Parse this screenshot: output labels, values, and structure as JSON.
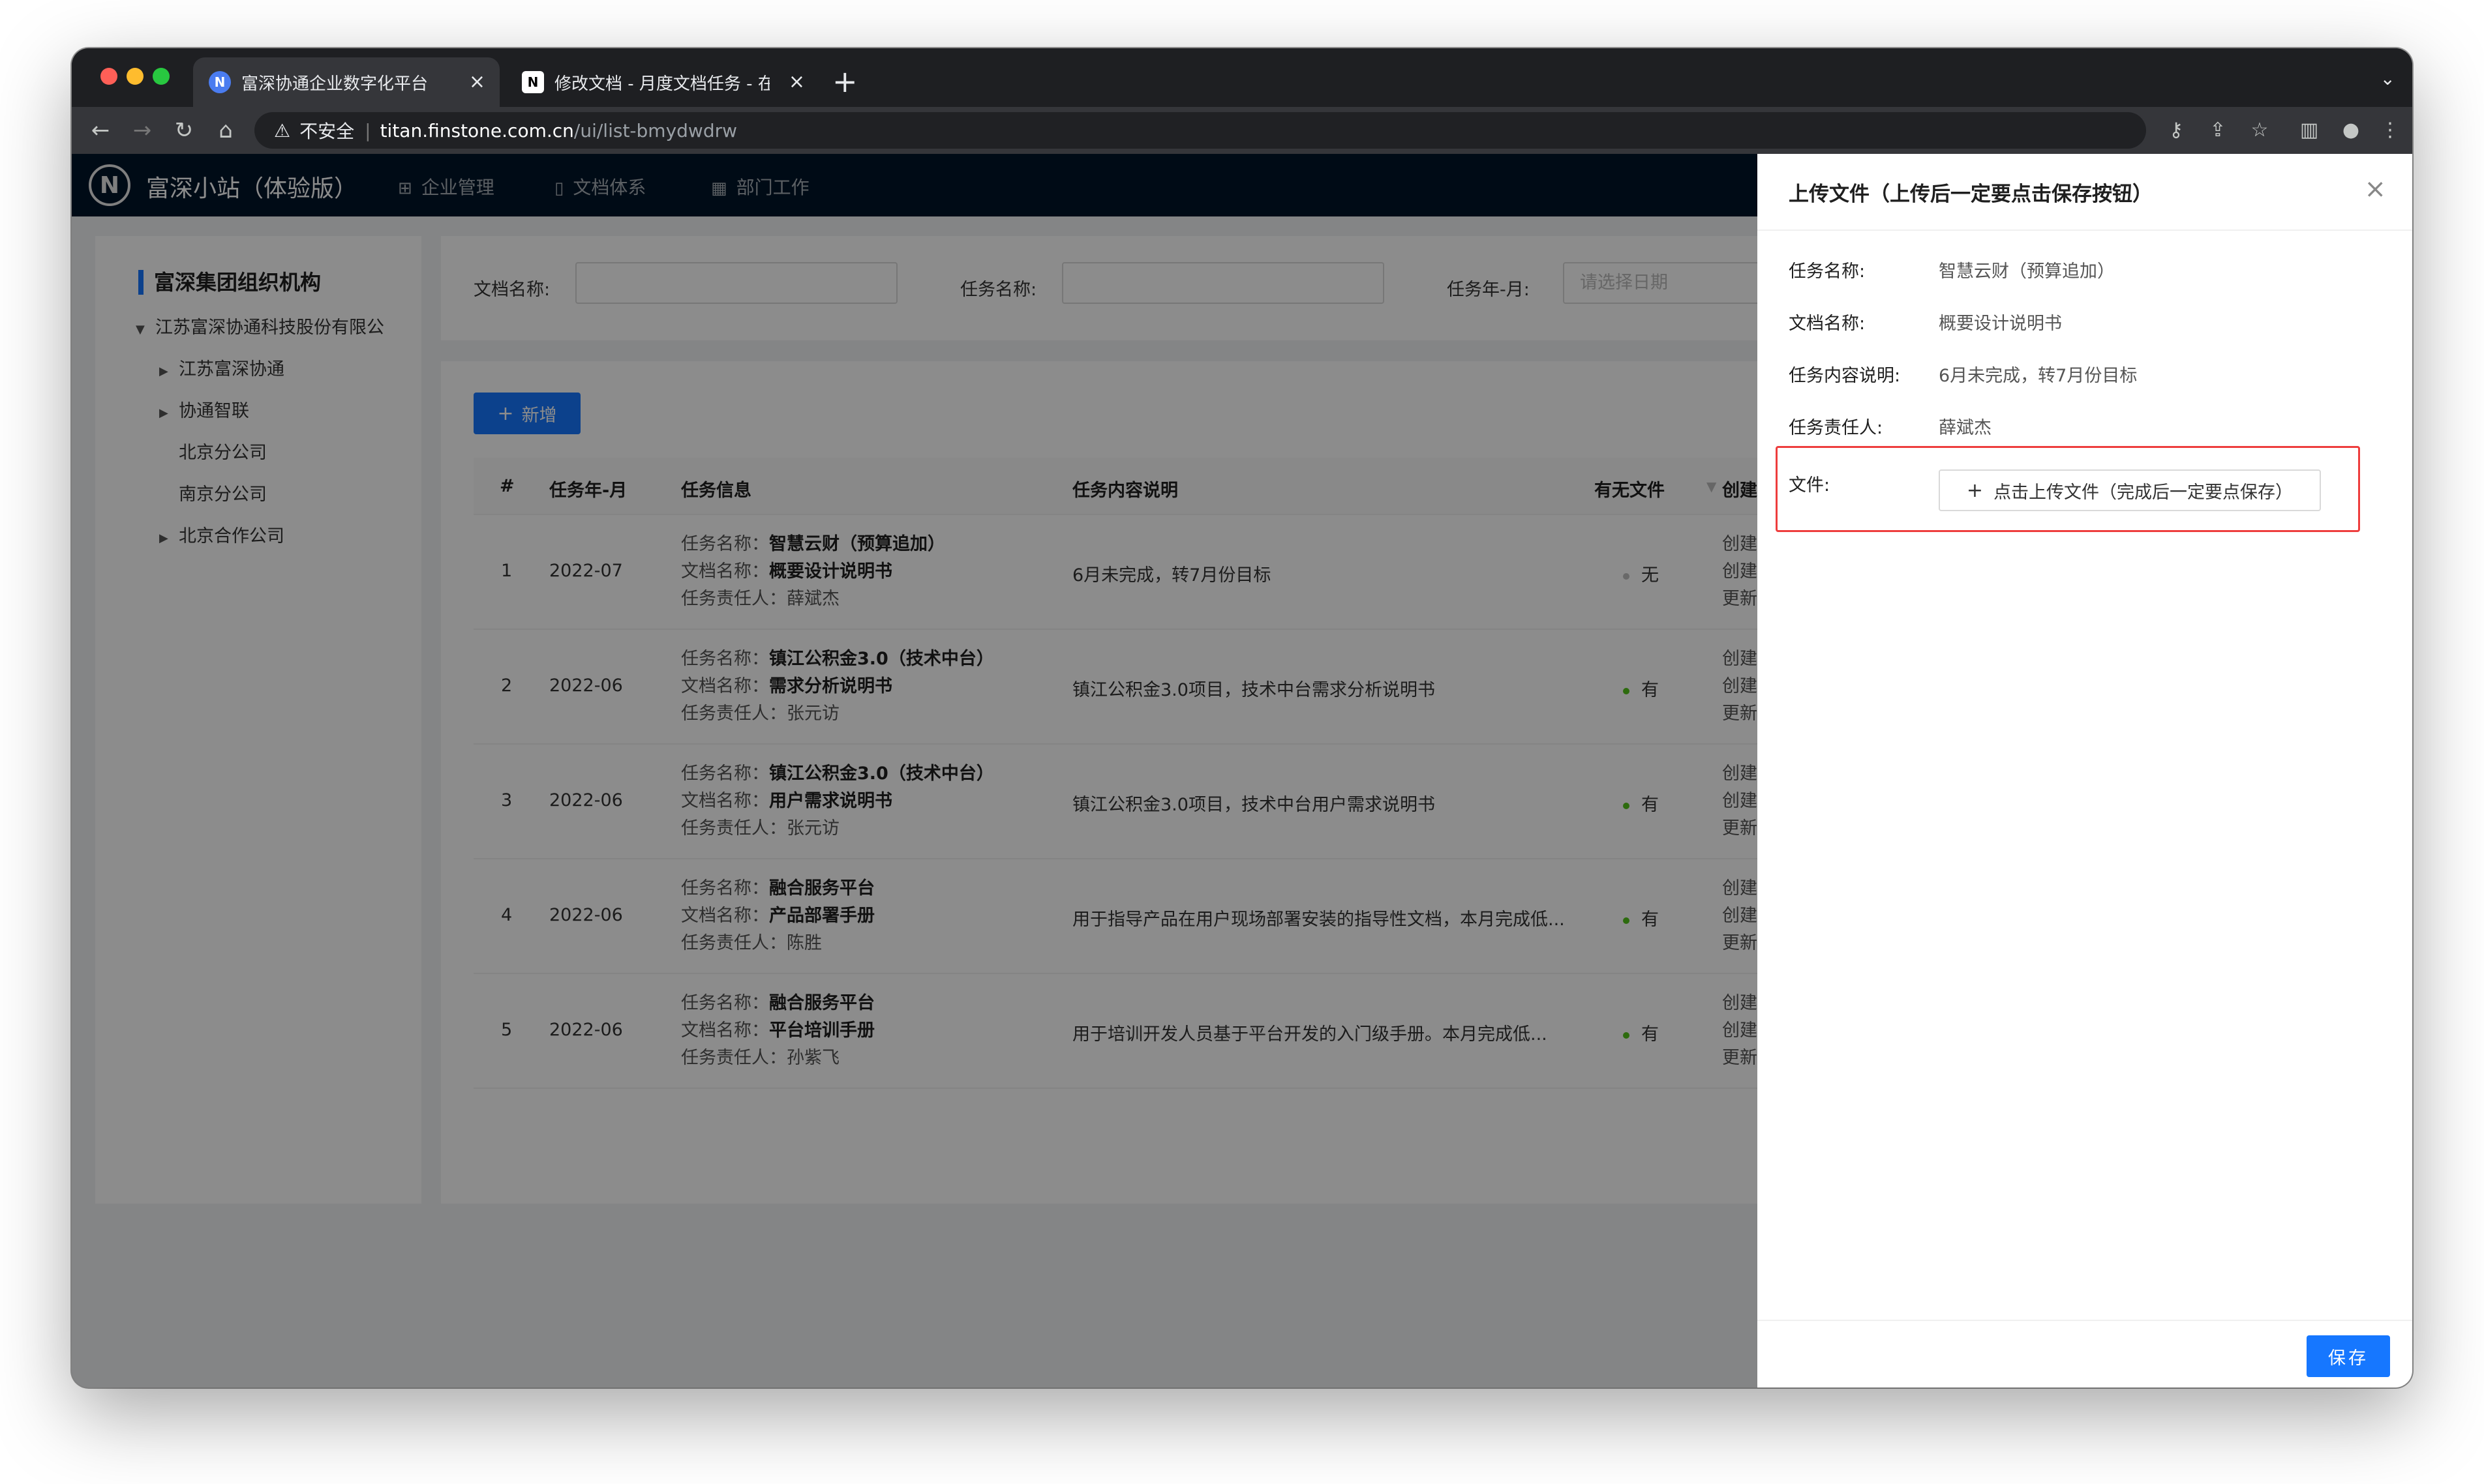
{
  "browser": {
    "tabs": [
      {
        "favicon": "N",
        "title": "富深协通企业数字化平台",
        "active": true
      },
      {
        "favicon": "N",
        "title": "修改文档 - 月度文档任务 - 在线文",
        "active": false
      }
    ],
    "new_tab": "+",
    "security_label": "不安全",
    "url_host": "titan.finstone.com.cn",
    "url_path": "/ui/list-bmydwdrw"
  },
  "app": {
    "logo_letter": "N",
    "site_name": "富深小站（体验版）",
    "nav": [
      {
        "label": "企业管理",
        "icon": "group-icon"
      },
      {
        "label": "文档体系",
        "icon": "file-icon"
      },
      {
        "label": "部门工作",
        "icon": "grid-icon"
      }
    ]
  },
  "tree": {
    "title": "富深集团组织机构",
    "nodes": [
      {
        "label": "江苏富深协通科技股份有限公",
        "level": 0,
        "expandable": true,
        "expanded": true
      },
      {
        "label": "江苏富深协通",
        "level": 1,
        "expandable": true,
        "expanded": false
      },
      {
        "label": "协通智联",
        "level": 1,
        "expandable": true,
        "expanded": false
      },
      {
        "label": "北京分公司",
        "level": 1,
        "expandable": false
      },
      {
        "label": "南京分公司",
        "level": 1,
        "expandable": false
      },
      {
        "label": "北京合作公司",
        "level": 1,
        "expandable": true,
        "expanded": false
      }
    ]
  },
  "search": {
    "doc_name_label": "文档名称:",
    "task_name_label": "任务名称:",
    "task_month_label": "任务年-月:",
    "date_placeholder": "请选择日期"
  },
  "table": {
    "add_button": "新增",
    "headers": {
      "index": "#",
      "month": "任务年-月",
      "info": "任务信息",
      "desc": "任务内容说明",
      "has_file": "有无文件",
      "created": "创建信息"
    },
    "labels": {
      "task_name": "任务名称：",
      "doc_name": "文档名称：",
      "owner": "任务责任人：",
      "creator": "创建人",
      "created_time": "创建时间",
      "updated_time": "更新时间"
    },
    "rows": [
      {
        "index": "1",
        "month": "2022-07",
        "task_name": "智慧云财（预算追加）",
        "doc_name": "概要设计说明书",
        "owner": "薛斌杰",
        "desc": "6月未完成，转7月份目标",
        "has_file": "无",
        "file_color": "#bfbfbf"
      },
      {
        "index": "2",
        "month": "2022-06",
        "task_name": "镇江公积金3.0（技术中台）",
        "doc_name": "需求分析说明书",
        "owner": "张元访",
        "desc": "镇江公积金3.0项目，技术中台需求分析说明书",
        "has_file": "有",
        "file_color": "#52c41a"
      },
      {
        "index": "3",
        "month": "2022-06",
        "task_name": "镇江公积金3.0（技术中台）",
        "doc_name": "用户需求说明书",
        "owner": "张元访",
        "desc": "镇江公积金3.0项目，技术中台用户需求说明书",
        "has_file": "有",
        "file_color": "#52c41a"
      },
      {
        "index": "4",
        "month": "2022-06",
        "task_name": "融合服务平台",
        "doc_name": "产品部署手册",
        "owner": "陈胜",
        "desc": "用于指导产品在用户现场部署安装的指导性文档，本月完成低...",
        "has_file": "有",
        "file_color": "#52c41a"
      },
      {
        "index": "5",
        "month": "2022-06",
        "task_name": "融合服务平台",
        "doc_name": "平台培训手册",
        "owner": "孙紫飞",
        "desc": "用于培训开发人员基于平台开发的入门级手册。本月完成低...",
        "has_file": "有",
        "file_color": "#52c41a"
      }
    ]
  },
  "drawer": {
    "title": "上传文件（上传后一定要点击保存按钮）",
    "fields": [
      {
        "label": "任务名称:",
        "value": "智慧云财（预算追加）"
      },
      {
        "label": "文档名称:",
        "value": "概要设计说明书"
      },
      {
        "label": "任务内容说明:",
        "value": "6月未完成，转7月份目标"
      },
      {
        "label": "任务责任人:",
        "value": "薛斌杰"
      }
    ],
    "file_label": "文件:",
    "upload_button": "点击上传文件（完成后一定要点保存）",
    "save_button": "保存"
  },
  "colors": {
    "primary": "#1677ff",
    "header_bg": "#001529",
    "highlight": "#ee3d3d",
    "success": "#52c41a"
  }
}
